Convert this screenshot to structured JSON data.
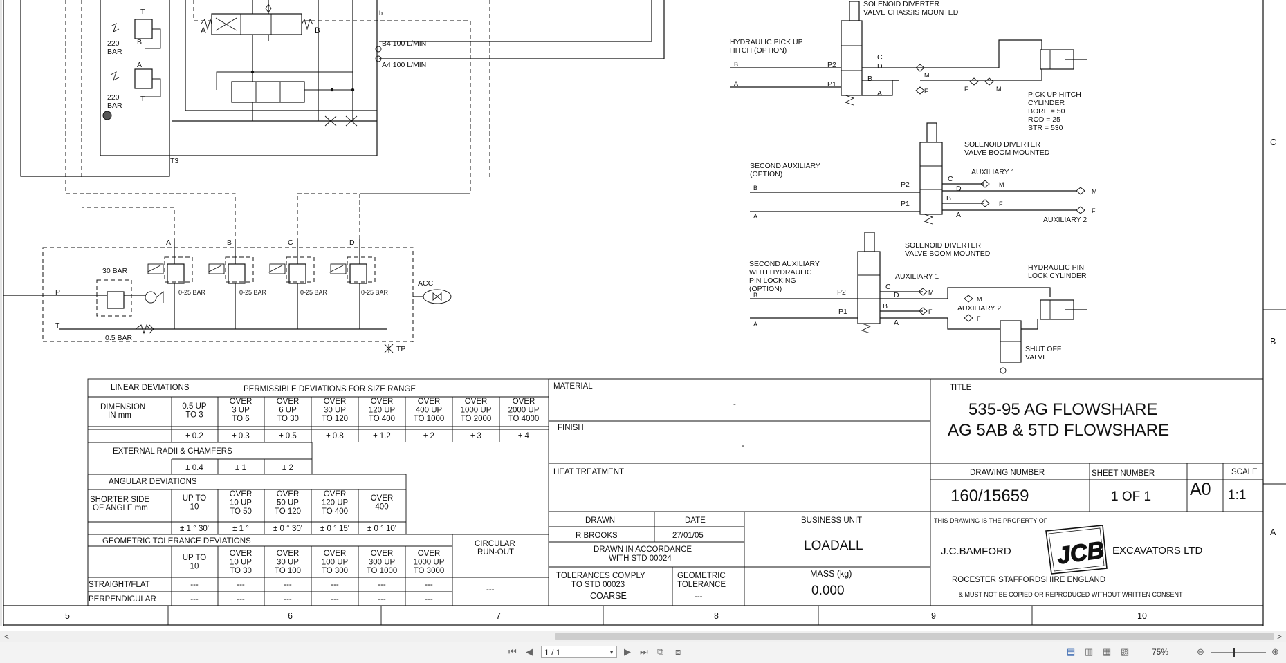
{
  "schematic": {
    "relief_valve_1": "220\nBAR",
    "relief_valve_2": "220\nBAR",
    "port_a": "A",
    "port_b": "B",
    "port_t": "T",
    "port_t3": "T3",
    "port_p": "P",
    "b4_flow": "B4 100 L/MIN",
    "a4_flow": "A4 100 L/MIN",
    "bar_30": "30 BAR",
    "bar_05": "0.5 BAR",
    "range_025_bar": "0-25 BAR",
    "acc": "ACC",
    "tp": "TP",
    "port_c": "C",
    "port_d": "D",
    "port_small_b": "b"
  },
  "options": {
    "diverter_chassis": "SOLENOID DIVERTER\nVALVE CHASSIS MOUNTED",
    "pickup_hitch_option": "HYDRAULIC PICK UP\nHITCH (OPTION)",
    "pickup_hitch_cylinder": "PICK UP HITCH\nCYLINDER\nBORE = 50\nROD  = 25\nSTR  = 530",
    "diverter_boom_1": "SOLENOID DIVERTER\nVALVE BOOM MOUNTED",
    "second_aux_option": "SECOND AUXILIARY\n(OPTION)",
    "auxiliary_1": "AUXILIARY 1",
    "auxiliary_2": "AUXILIARY 2",
    "diverter_boom_2": "SOLENOID DIVERTER\nVALVE BOOM MOUNTED",
    "second_aux_pin_locking": "SECOND AUXILIARY\nWITH HYDRAULIC\nPIN LOCKING\n(OPTION)",
    "pin_lock_cylinder": "HYDRAULIC PIN\nLOCK CYLINDER",
    "shut_off_valve": "SHUT OFF\nVALVE",
    "p1": "P1",
    "p2": "P2",
    "m": "M",
    "f": "F",
    "d": "D"
  },
  "tolerance_table": {
    "linear_deviations": "LINEAR DEVIATIONS",
    "permissible": "PERMISSIBLE DEVIATIONS FOR SIZE RANGE",
    "dimension": "DIMENSION\nIN mm",
    "linear_headers": [
      "0.5 UP\nTO 3",
      "OVER\n3 UP\nTO 6",
      "OVER\n6 UP\nTO 30",
      "OVER\n30 UP\nTO 120",
      "OVER\n120 UP\nTO 400",
      "OVER\n400 UP\nTO 1000",
      "OVER\n1000 UP\nTO 2000",
      "OVER\n2000 UP\nTO 4000"
    ],
    "linear_values": [
      "± 0.2",
      "± 0.3",
      "± 0.5",
      "± 0.8",
      "± 1.2",
      "± 2",
      "± 3",
      "± 4"
    ],
    "external_radii": "EXTERNAL RADII & CHAMFERS",
    "radii_values": [
      "± 0.4",
      "± 1",
      "± 2"
    ],
    "angular_deviations": "ANGULAR DEVIATIONS",
    "shorter_side": "SHORTER SIDE\nOF ANGLE mm",
    "angular_headers": [
      "UP TO\n10",
      "OVER\n10 UP\nTO 50",
      "OVER\n50 UP\nTO 120",
      "OVER\n120 UP\nTO 400",
      "OVER\n400"
    ],
    "angular_values": [
      "± 1 °  30'",
      "± 1 °",
      "± 0 °  30'",
      "± 0 °  15'",
      "± 0 °  10'"
    ],
    "geometric_tolerance": "GEOMETRIC TOLERANCE DEVIATIONS",
    "geo_headers": [
      "UP TO\n10",
      "OVER\n10 UP\nTO 30",
      "OVER\n30 UP\nTO 100",
      "OVER\n100 UP\nTO 300",
      "OVER\n300 UP\nTO 1000",
      "OVER\n1000 UP\nTO 3000"
    ],
    "circular_runout": "CIRCULAR\nRUN-OUT",
    "straight_flat": "STRAIGHT/FLAT",
    "perpendicular": "PERPENDICULAR",
    "dash": "---"
  },
  "title_block": {
    "material_label": "MATERIAL",
    "material_value": "-",
    "finish_label": "FINISH",
    "finish_value": "-",
    "heat_treatment_label": "HEAT TREATMENT",
    "title_label": "TITLE",
    "title_line1": "535-95 AG FLOWSHARE",
    "title_line2": "AG 5AB & 5TD FLOWSHARE",
    "drawing_number_label": "DRAWING NUMBER",
    "drawing_number": "160/15659",
    "sheet_number_label": "SHEET NUMBER",
    "sheet_number": "1   OF   1",
    "size": "A0",
    "scale_label": "SCALE",
    "scale": "1:1",
    "drawn_label": "DRAWN",
    "drawn_by": "R BROOKS",
    "date_label": "DATE",
    "date": "27/01/05",
    "business_unit_label": "BUSINESS UNIT",
    "business_unit": "LOADALL",
    "drawn_accordance": "DRAWN IN ACCORDANCE\nWITH STD 00024",
    "tolerances_comply": "TOLERANCES COMPLY\nTO STD 00023",
    "coarse": "COARSE",
    "geometric_tolerance": "GEOMETRIC\nTOLERANCE",
    "geo_value": "---",
    "mass_label": "MASS (kg)",
    "mass": "0.000",
    "property_note": "THIS DRAWING IS THE PROPERTY OF",
    "company_left": "J.C.BAMFORD",
    "company_right": "EXCAVATORS LTD",
    "logo_text": "JCB",
    "location": "ROCESTER     STAFFORDSHIRE     ENGLAND",
    "copy_note": "& MUST NOT BE COPIED OR REPRODUCED WITHOUT WRITTEN CONSENT"
  },
  "grid": {
    "columns": [
      "5",
      "6",
      "7",
      "8",
      "9",
      "10"
    ],
    "rows": [
      "C",
      "B",
      "A"
    ]
  },
  "viewer": {
    "page_field": "1 / 1",
    "zoom": "75%",
    "scroll_left": "<",
    "scroll_right": ">"
  }
}
